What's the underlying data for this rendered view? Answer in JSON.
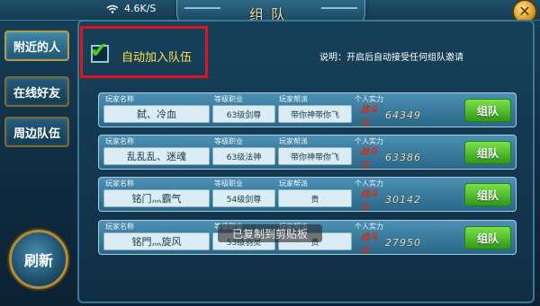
{
  "status_bar": {
    "network_speed": "4.6K/S"
  },
  "window": {
    "title": "组队"
  },
  "tabs": [
    {
      "label": "附近的人"
    },
    {
      "label": "在线好友"
    },
    {
      "label": "周边队伍"
    }
  ],
  "refresh_label": "刷新",
  "auto_join": {
    "label": "自动加入队伍",
    "checked": true
  },
  "description": "说明：开启后自动接受任何组队邀请",
  "column_headers": {
    "name": "玩家名称",
    "level": "等级职业",
    "faction": "玩家帮派",
    "power": "个人实力"
  },
  "power_label": "战斗力",
  "team_button_label": "组队",
  "players": [
    {
      "name": "弑、冷血",
      "level": "63级剑尊",
      "faction": "带你神带你飞",
      "power": "64349"
    },
    {
      "name": "乱乱乱、迷魂",
      "level": "63级法神",
      "faction": "带你神带你飞",
      "power": "63386"
    },
    {
      "name": "铭门灬霸气",
      "level": "54级剑尊",
      "faction": "贵",
      "power": "30142"
    },
    {
      "name": "铭門灬旋风",
      "level": "53级羽灵",
      "faction": "贵",
      "power": "27950"
    }
  ],
  "toast": "已复制到剪贴板",
  "colors": {
    "accent_gold": "#ffe14a",
    "highlight_red": "#e1141d",
    "button_green": "#3fae20"
  }
}
